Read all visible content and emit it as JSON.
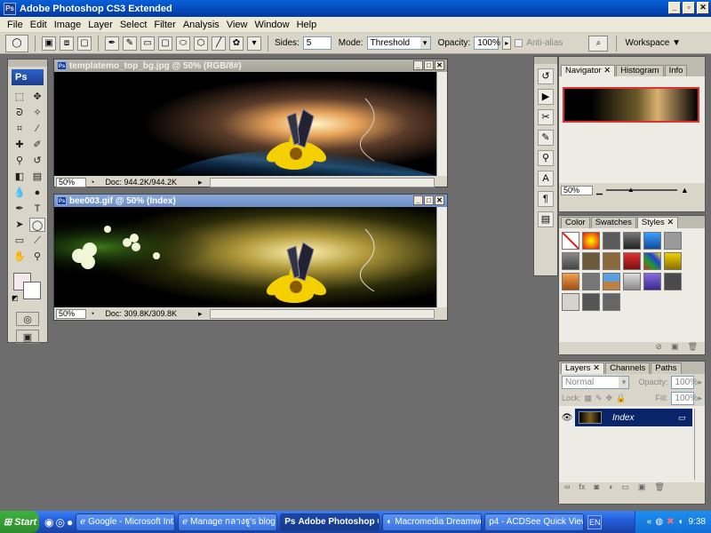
{
  "app": {
    "title": "Adobe Photoshop CS3 Extended",
    "icon": "ps-app-icon"
  },
  "menu": [
    "File",
    "Edit",
    "Image",
    "Layer",
    "Select",
    "Filter",
    "Analysis",
    "View",
    "Window",
    "Help"
  ],
  "options": {
    "sides_label": "Sides:",
    "sides_value": "5",
    "mode_label": "Mode:",
    "mode_value": "Threshold",
    "opacity_label": "Opacity:",
    "opacity_value": "100%",
    "antialias_label": "Anti-alias",
    "workspace_label": "Workspace"
  },
  "toolbox": {
    "logo": "Ps"
  },
  "documents": [
    {
      "title": "templatemo_top_bg.jpg @ 50% (RGB/8#)",
      "zoom": "50%",
      "doc_info": "Doc: 944.2K/944.2K"
    },
    {
      "title": "bee003.gif @ 50% (Index)",
      "zoom": "50%",
      "doc_info": "Doc: 309.8K/309.8K"
    }
  ],
  "navigator_panel": {
    "tabs": [
      "Navigator",
      "Histogram",
      "Info"
    ],
    "zoom": "50%"
  },
  "styles_panel": {
    "tabs": [
      "Color",
      "Swatches",
      "Styles"
    ]
  },
  "layers_panel": {
    "tabs": [
      "Layers",
      "Channels",
      "Paths"
    ],
    "blend_mode": "Normal",
    "opacity_label": "Opacity:",
    "opacity_value": "100%",
    "lock_label": "Lock:",
    "fill_label": "Fill:",
    "fill_value": "100%",
    "layer_name": "Index"
  },
  "taskbar": {
    "start": "Start",
    "tasks": [
      "Google - Microsoft Int...",
      "Manage กลางฐู's blog ...",
      "Adobe Photoshop C...",
      "Macromedia Dreamwe...",
      "p4 - ACDSee Quick View"
    ],
    "language": "EN",
    "clock": "9:38"
  },
  "colors": {
    "title_bar": "#0348b8",
    "layer_selected": "#0a246a",
    "taskbar": "#245edb"
  }
}
